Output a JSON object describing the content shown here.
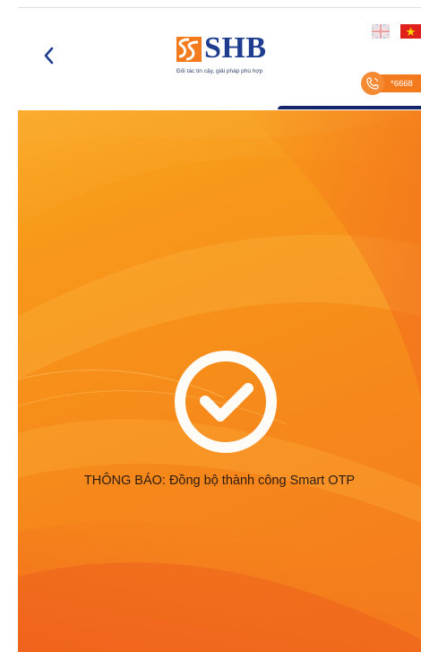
{
  "header": {
    "back_icon": "chevron-left-icon",
    "logo": {
      "brand": "SHB",
      "tagline": "Đối tác tin cậy, giải pháp phù hợp"
    },
    "languages": [
      {
        "code": "en",
        "icon": "uk-flag-icon"
      },
      {
        "code": "vi",
        "icon": "vietnam-flag-icon"
      }
    ],
    "hotline": {
      "icon": "phone-icon",
      "number": "*6668"
    }
  },
  "notification": {
    "icon": "checkmark-circle-icon",
    "message": "THÔNG BÁO: Đồng bộ thành công Smart OTP"
  },
  "colors": {
    "brand_blue": "#1f3d8f",
    "brand_orange": "#f47a1e",
    "accent_navy": "#14256b",
    "background_orange": "#f7921a"
  }
}
